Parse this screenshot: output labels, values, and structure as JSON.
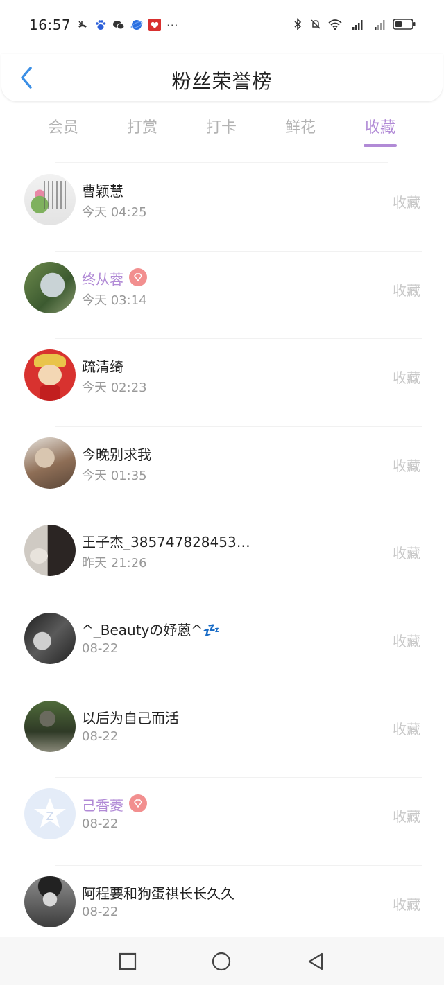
{
  "status_bar": {
    "time": "16:57",
    "left_icons": [
      "missed-call-icon",
      "baidu-paw-icon",
      "wechat-icon",
      "blue-ball-app-icon",
      "red-heart-app-icon",
      "more-dots-icon"
    ],
    "more": "···",
    "right_icons": [
      "bluetooth-icon",
      "mute-bell-icon",
      "wifi-6-icon",
      "signal-5g-icon",
      "signal-5g-2-icon",
      "battery-icon"
    ]
  },
  "header": {
    "title": "粉丝荣誉榜",
    "back_icon": "chevron-left-icon"
  },
  "tabs": [
    {
      "label": "会员",
      "active": false
    },
    {
      "label": "打赏",
      "active": false
    },
    {
      "label": "打卡",
      "active": false
    },
    {
      "label": "鲜花",
      "active": false
    },
    {
      "label": "收藏",
      "active": true
    }
  ],
  "colors": {
    "accent": "#b18ad6",
    "badge": "#f28f8f",
    "action": "#c8c8c8"
  },
  "fans": [
    {
      "name": "曹颖慧",
      "time": "今天 04:25",
      "action": "收藏",
      "vip": false
    },
    {
      "name": "终从蓉",
      "time": "今天 03:14",
      "action": "收藏",
      "vip": true
    },
    {
      "name": "疏清绮",
      "time": "今天 02:23",
      "action": "收藏",
      "vip": false
    },
    {
      "name": "今晚别求我",
      "time": "今天 01:35",
      "action": "收藏",
      "vip": false
    },
    {
      "name": "王子杰_3857478284539...",
      "time": "昨天 21:26",
      "action": "收藏",
      "vip": false
    },
    {
      "name": "^_Beautyの妤蒽^💤",
      "time": "08-22",
      "action": "收藏",
      "vip": false
    },
    {
      "name": "以后为自己而活",
      "time": "08-22",
      "action": "收藏",
      "vip": false
    },
    {
      "name": "己香菱",
      "time": "08-22",
      "action": "收藏",
      "vip": true
    },
    {
      "name": "阿程要和狗蛋祺长长久久",
      "time": "08-22",
      "action": "收藏",
      "vip": false
    }
  ],
  "nav_bar": {
    "buttons": [
      "recent-apps-square-icon",
      "home-circle-icon",
      "back-triangle-icon"
    ]
  }
}
